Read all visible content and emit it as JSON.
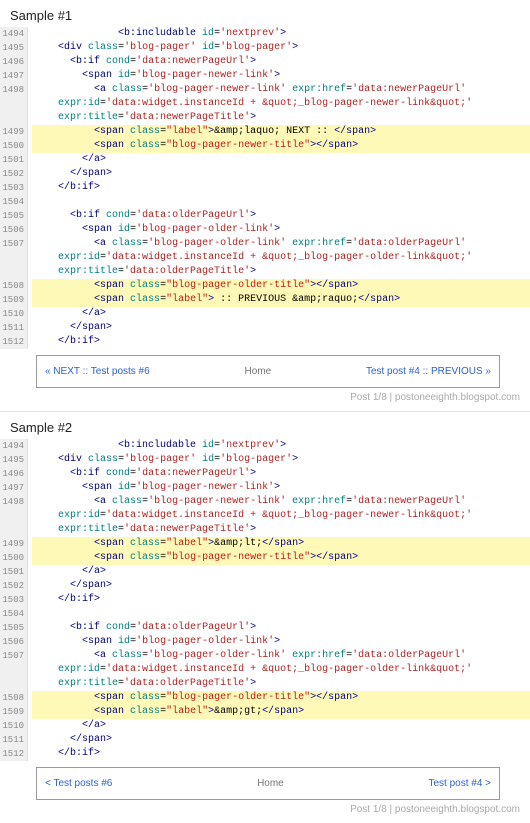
{
  "samples": [
    {
      "heading": "Sample #1",
      "lines": [
        {
          "n": "1494",
          "hl": false,
          "indent": 14,
          "html": "<span class='t-tag'>&lt;b:includable</span> <span class='t-attr'>id</span>=<span class='t-val'>'nextprev'</span><span class='t-tag'>&gt;</span>"
        },
        {
          "n": "1495",
          "hl": false,
          "indent": 4,
          "html": "<span class='t-tag'>&lt;div</span> <span class='t-attr'>class</span>=<span class='t-val'>'blog-pager'</span> <span class='t-attr'>id</span>=<span class='t-val'>'blog-pager'</span><span class='t-tag'>&gt;</span>"
        },
        {
          "n": "1496",
          "hl": false,
          "indent": 6,
          "html": "<span class='t-tag'>&lt;b:if</span> <span class='t-attr'>cond</span>=<span class='t-val'>'data:newerPageUrl'</span><span class='t-tag'>&gt;</span>"
        },
        {
          "n": "1497",
          "hl": false,
          "indent": 8,
          "html": "<span class='t-tag'>&lt;span</span> <span class='t-attr'>id</span>=<span class='t-val'>'blog-pager-newer-link'</span><span class='t-tag'>&gt;</span>"
        },
        {
          "n": "1498",
          "hl": false,
          "indent": 10,
          "html": "<span class='t-tag'>&lt;a</span> <span class='t-attr'>class</span>=<span class='t-val'>'blog-pager-newer-link'</span> <span class='t-attr'>expr:href</span>=<span class='t-val'>'data:newerPageUrl'</span>"
        },
        {
          "n": "",
          "hl": false,
          "indent": 4,
          "html": "<span class='t-attr'>expr:id</span>=<span class='t-val'>'data:widget.instanceId + &amp;quot;_blog-pager-newer-link&amp;quot;'</span>"
        },
        {
          "n": "",
          "hl": false,
          "indent": 4,
          "html": "<span class='t-attr'>expr:title</span>=<span class='t-val'>'data:newerPageTitle'</span><span class='t-tag'>&gt;</span>"
        },
        {
          "n": "1499",
          "hl": true,
          "indent": 10,
          "html": "<span class='t-tag'>&lt;span</span> <span class='t-attr'>class</span>=<span class='t-str'>\"label\"</span><span class='t-tag'>&gt;</span>&amp;amp;laquo; NEXT :: <span class='t-tag'>&lt;/span&gt;</span>"
        },
        {
          "n": "1500",
          "hl": true,
          "indent": 10,
          "html": "<span class='t-tag'>&lt;span</span> <span class='t-attr'>class</span>=<span class='t-str'>\"blog-pager-newer-title\"</span><span class='t-tag'>&gt;&lt;/span&gt;</span>"
        },
        {
          "n": "1501",
          "hl": false,
          "indent": 8,
          "html": "<span class='t-tag'>&lt;/a&gt;</span>"
        },
        {
          "n": "1502",
          "hl": false,
          "indent": 6,
          "html": "<span class='t-tag'>&lt;/span&gt;</span>"
        },
        {
          "n": "1503",
          "hl": false,
          "indent": 4,
          "html": "<span class='t-tag'>&lt;/b:if&gt;</span>"
        },
        {
          "n": "1504",
          "hl": false,
          "indent": 0,
          "html": ""
        },
        {
          "n": "1505",
          "hl": false,
          "indent": 6,
          "html": "<span class='t-tag'>&lt;b:if</span> <span class='t-attr'>cond</span>=<span class='t-val'>'data:olderPageUrl'</span><span class='t-tag'>&gt;</span>"
        },
        {
          "n": "1506",
          "hl": false,
          "indent": 8,
          "html": "<span class='t-tag'>&lt;span</span> <span class='t-attr'>id</span>=<span class='t-val'>'blog-pager-older-link'</span><span class='t-tag'>&gt;</span>"
        },
        {
          "n": "1507",
          "hl": false,
          "indent": 10,
          "html": "<span class='t-tag'>&lt;a</span> <span class='t-attr'>class</span>=<span class='t-val'>'blog-pager-older-link'</span> <span class='t-attr'>expr:href</span>=<span class='t-val'>'data:olderPageUrl'</span>"
        },
        {
          "n": "",
          "hl": false,
          "indent": 4,
          "html": "<span class='t-attr'>expr:id</span>=<span class='t-val'>'data:widget.instanceId + &amp;quot;_blog-pager-older-link&amp;quot;'</span>"
        },
        {
          "n": "",
          "hl": false,
          "indent": 4,
          "html": "<span class='t-attr'>expr:title</span>=<span class='t-val'>'data:olderPageTitle'</span><span class='t-tag'>&gt;</span>"
        },
        {
          "n": "1508",
          "hl": true,
          "indent": 10,
          "html": "<span class='t-tag'>&lt;span</span> <span class='t-attr'>class</span>=<span class='t-str'>\"blog-pager-older-title\"</span><span class='t-tag'>&gt;&lt;/span&gt;</span>"
        },
        {
          "n": "1509",
          "hl": true,
          "indent": 10,
          "html": "<span class='t-tag'>&lt;span</span> <span class='t-attr'>class</span>=<span class='t-str'>\"label\"</span><span class='t-tag'>&gt;</span> :: PREVIOUS &amp;amp;raquo;<span class='t-tag'>&lt;/span&gt;</span>"
        },
        {
          "n": "1510",
          "hl": false,
          "indent": 8,
          "html": "<span class='t-tag'>&lt;/a&gt;</span>"
        },
        {
          "n": "1511",
          "hl": false,
          "indent": 6,
          "html": "<span class='t-tag'>&lt;/span&gt;</span>"
        },
        {
          "n": "1512",
          "hl": false,
          "indent": 4,
          "html": "<span class='t-tag'>&lt;/b:if&gt;</span>"
        }
      ],
      "preview": {
        "newer": "« NEXT :: Test posts #6",
        "home": "Home",
        "older": "Test post #4 :: PREVIOUS »"
      },
      "caption": "Post 1/8 | postoneeighth.blogspot.com"
    },
    {
      "heading": "Sample #2",
      "lines": [
        {
          "n": "1494",
          "hl": false,
          "indent": 14,
          "html": "<span class='t-tag'>&lt;b:includable</span> <span class='t-attr'>id</span>=<span class='t-val'>'nextprev'</span><span class='t-tag'>&gt;</span>"
        },
        {
          "n": "1495",
          "hl": false,
          "indent": 4,
          "html": "<span class='t-tag'>&lt;div</span> <span class='t-attr'>class</span>=<span class='t-val'>'blog-pager'</span> <span class='t-attr'>id</span>=<span class='t-val'>'blog-pager'</span><span class='t-tag'>&gt;</span>"
        },
        {
          "n": "1496",
          "hl": false,
          "indent": 6,
          "html": "<span class='t-tag'>&lt;b:if</span> <span class='t-attr'>cond</span>=<span class='t-val'>'data:newerPageUrl'</span><span class='t-tag'>&gt;</span>"
        },
        {
          "n": "1497",
          "hl": false,
          "indent": 8,
          "html": "<span class='t-tag'>&lt;span</span> <span class='t-attr'>id</span>=<span class='t-val'>'blog-pager-newer-link'</span><span class='t-tag'>&gt;</span>"
        },
        {
          "n": "1498",
          "hl": false,
          "indent": 10,
          "html": "<span class='t-tag'>&lt;a</span> <span class='t-attr'>class</span>=<span class='t-val'>'blog-pager-newer-link'</span> <span class='t-attr'>expr:href</span>=<span class='t-val'>'data:newerPageUrl'</span>"
        },
        {
          "n": "",
          "hl": false,
          "indent": 4,
          "html": "<span class='t-attr'>expr:id</span>=<span class='t-val'>'data:widget.instanceId + &amp;quot;_blog-pager-newer-link&amp;quot;'</span>"
        },
        {
          "n": "",
          "hl": false,
          "indent": 4,
          "html": "<span class='t-attr'>expr:title</span>=<span class='t-val'>'data:newerPageTitle'</span><span class='t-tag'>&gt;</span>"
        },
        {
          "n": "1499",
          "hl": true,
          "indent": 10,
          "html": "<span class='t-tag'>&lt;span</span> <span class='t-attr'>class</span>=<span class='t-str'>\"label\"</span><span class='t-tag'>&gt;</span>&amp;amp;lt;<span class='t-tag'>&lt;/span&gt;</span>"
        },
        {
          "n": "1500",
          "hl": true,
          "indent": 10,
          "html": "<span class='t-tag'>&lt;span</span> <span class='t-attr'>class</span>=<span class='t-str'>\"blog-pager-newer-title\"</span><span class='t-tag'>&gt;&lt;/span&gt;</span>"
        },
        {
          "n": "1501",
          "hl": false,
          "indent": 8,
          "html": "<span class='t-tag'>&lt;/a&gt;</span>"
        },
        {
          "n": "1502",
          "hl": false,
          "indent": 6,
          "html": "<span class='t-tag'>&lt;/span&gt;</span>"
        },
        {
          "n": "1503",
          "hl": false,
          "indent": 4,
          "html": "<span class='t-tag'>&lt;/b:if&gt;</span>"
        },
        {
          "n": "1504",
          "hl": false,
          "indent": 0,
          "html": ""
        },
        {
          "n": "1505",
          "hl": false,
          "indent": 6,
          "html": "<span class='t-tag'>&lt;b:if</span> <span class='t-attr'>cond</span>=<span class='t-val'>'data:olderPageUrl'</span><span class='t-tag'>&gt;</span>"
        },
        {
          "n": "1506",
          "hl": false,
          "indent": 8,
          "html": "<span class='t-tag'>&lt;span</span> <span class='t-attr'>id</span>=<span class='t-val'>'blog-pager-older-link'</span><span class='t-tag'>&gt;</span>"
        },
        {
          "n": "1507",
          "hl": false,
          "indent": 10,
          "html": "<span class='t-tag'>&lt;a</span> <span class='t-attr'>class</span>=<span class='t-val'>'blog-pager-older-link'</span> <span class='t-attr'>expr:href</span>=<span class='t-val'>'data:olderPageUrl'</span>"
        },
        {
          "n": "",
          "hl": false,
          "indent": 4,
          "html": "<span class='t-attr'>expr:id</span>=<span class='t-val'>'data:widget.instanceId + &amp;quot;_blog-pager-older-link&amp;quot;'</span>"
        },
        {
          "n": "",
          "hl": false,
          "indent": 4,
          "html": "<span class='t-attr'>expr:title</span>=<span class='t-val'>'data:olderPageTitle'</span><span class='t-tag'>&gt;</span>"
        },
        {
          "n": "1508",
          "hl": true,
          "indent": 10,
          "html": "<span class='t-tag'>&lt;span</span> <span class='t-attr'>class</span>=<span class='t-str'>\"blog-pager-older-title\"</span><span class='t-tag'>&gt;&lt;/span&gt;</span>"
        },
        {
          "n": "1509",
          "hl": true,
          "indent": 10,
          "html": "<span class='t-tag'>&lt;span</span> <span class='t-attr'>class</span>=<span class='t-str'>\"label\"</span><span class='t-tag'>&gt;</span>&amp;amp;gt;<span class='t-tag'>&lt;/span&gt;</span>"
        },
        {
          "n": "1510",
          "hl": false,
          "indent": 8,
          "html": "<span class='t-tag'>&lt;/a&gt;</span>"
        },
        {
          "n": "1511",
          "hl": false,
          "indent": 6,
          "html": "<span class='t-tag'>&lt;/span&gt;</span>"
        },
        {
          "n": "1512",
          "hl": false,
          "indent": 4,
          "html": "<span class='t-tag'>&lt;/b:if&gt;</span>"
        }
      ],
      "preview": {
        "newer": "< Test posts #6",
        "home": "Home",
        "older": "Test post #4 >"
      },
      "caption": "Post 1/8 | postoneeighth.blogspot.com"
    }
  ]
}
